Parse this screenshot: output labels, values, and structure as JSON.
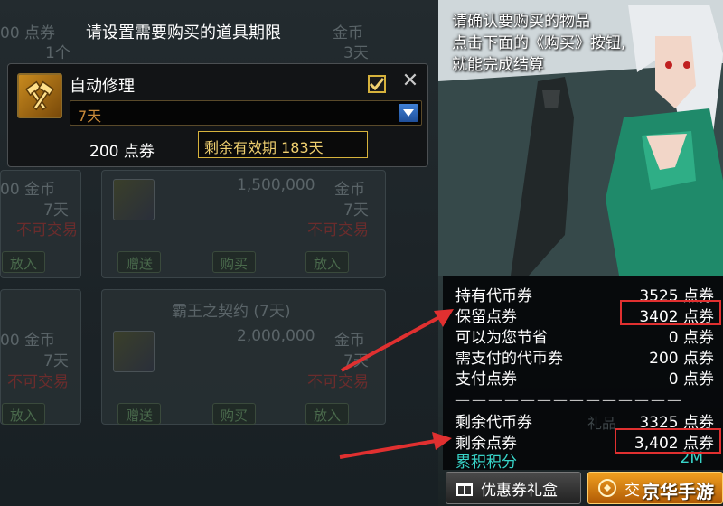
{
  "dialog": {
    "title": "请设置需要购买的道具期限",
    "item_name": "自动修理",
    "period_selected": "7天",
    "price": "200 点券",
    "validity": "剩余有效期 183天"
  },
  "background_shop": {
    "top_price_1": "00 点券",
    "top_count": "1个",
    "top_gold": "金币",
    "top_days": "3天",
    "row1_left_price": "00 金币",
    "row1_left_days": "7天",
    "row1_left_status": "不可交易",
    "row1_right_price": "1,500,000",
    "row1_right_unit": "金币",
    "row1_right_days": "7天",
    "row1_right_status": "不可交易",
    "btn_gift": "赠送",
    "btn_buy": "购买",
    "btn_collect": "放入",
    "card_title": "霸王之契约 (7天)",
    "row2_left_price": "00 金币",
    "row2_left_days": "7天",
    "row2_left_status": "不可交易",
    "row2_right_price": "2,000,000",
    "row2_right_unit": "金币",
    "row2_right_days": "7天",
    "row2_right_status": "不可交易"
  },
  "npc": {
    "speech_line1": "请确认要购买的物品",
    "speech_line2": "点击下面的《购买》按钮,",
    "speech_line3": "就能完成结算"
  },
  "stats": {
    "rows_top": [
      {
        "label": "持有代币券",
        "value": "3525 点券"
      },
      {
        "label": "保留点券",
        "value": "3402 点券"
      },
      {
        "label": "可以为您节省",
        "value": "0 点券"
      },
      {
        "label": "需支付的代币券",
        "value": "200 点券"
      },
      {
        "label": "支付点券",
        "value": "0 点券"
      }
    ],
    "divider": "——————————————",
    "rows_bottom": [
      {
        "label": "剩余代币券",
        "value": "3325 点券"
      },
      {
        "label": "剩余点券",
        "value": "3,402 点券"
      },
      {
        "label": "累积积分",
        "value": "2M"
      }
    ],
    "faded_gift": "礼品"
  },
  "buttons": {
    "coupon": "优惠券礼盒",
    "buy_partial": "交"
  },
  "watermark": "京华手游",
  "colors": {
    "accent_gold": "#d6b23c",
    "highlight_red": "#e03030",
    "teal": "#38d4c8",
    "buy_orange": "#f0a020"
  }
}
